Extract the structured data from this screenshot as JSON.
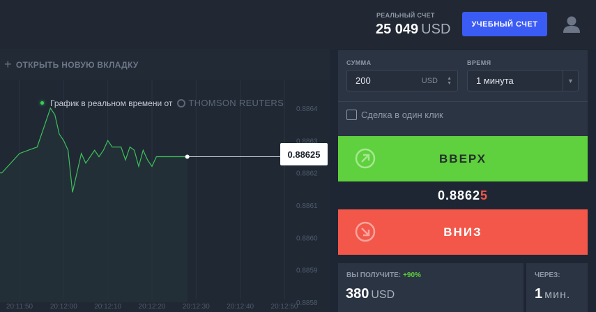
{
  "account": {
    "label": "РЕАЛЬНЫЙ СЧЕТ",
    "balance": "25 049",
    "currency": "USD",
    "demo_button": "УЧЕБНЫЙ СЧЕТ"
  },
  "tabs": {
    "new_tab": "ОТКРЫТЬ НОВУЮ ВКЛАДКУ"
  },
  "chart_header": {
    "text": "График в реальном времени от",
    "provider": "THOMSON REUTERS"
  },
  "price_tag": "0.88625",
  "chart_data": {
    "type": "line",
    "x_ticks": [
      "20:11:50",
      "20:12:00",
      "20:12:10",
      "20:12:20",
      "20:12:30",
      "20:12:40",
      "20:12:50"
    ],
    "y_ticks": [
      "0.8864",
      "0.8863",
      "0.8862",
      "0.8861",
      "0.8860",
      "0.8859",
      "0.8858"
    ],
    "ylim": [
      0.8858,
      0.8864
    ],
    "xlim": [
      -5,
      54
    ],
    "series": [
      {
        "x": [
          -5,
          -4,
          0,
          2,
          4,
          6,
          7,
          8,
          9,
          10,
          11,
          12,
          14,
          15,
          16,
          17,
          18,
          19,
          20,
          21,
          22,
          23,
          24,
          25,
          26,
          27,
          28,
          29,
          30,
          31,
          32,
          33,
          34,
          35,
          38
        ],
        "y": [
          0.8862,
          0.8862,
          0.88626,
          0.88627,
          0.88628,
          0.88636,
          0.8864,
          0.88638,
          0.88632,
          0.8863,
          0.88627,
          0.88614,
          0.88626,
          0.88623,
          0.88625,
          0.88627,
          0.88625,
          0.88627,
          0.8863,
          0.88628,
          0.88628,
          0.88628,
          0.88624,
          0.88628,
          0.88627,
          0.88622,
          0.88627,
          0.88624,
          0.88622,
          0.88625,
          0.88625,
          0.88625,
          0.88625,
          0.88625,
          0.88625
        ]
      }
    ],
    "colors": {
      "line": "#3cc15a",
      "grid": "#2a3340"
    }
  },
  "trade": {
    "amount_label": "СУММА",
    "amount_value": "200",
    "amount_currency": "USD",
    "time_label": "ВРЕМЯ",
    "time_value": "1 минута",
    "one_click_label": "Сделка в один клик",
    "up_label": "ВВЕРХ",
    "down_label": "ВНИЗ",
    "current_price_main": "0.8862",
    "current_price_last": "5",
    "colors": {
      "up": "#5fd03e",
      "down": "#f2574a"
    }
  },
  "payout": {
    "label": "ВЫ ПОЛУЧИТЕ:",
    "percent": "+90%",
    "value": "380",
    "currency": "USD"
  },
  "expiry": {
    "label": "ЧЕРЕЗ:",
    "value": "1",
    "unit": "мин."
  }
}
